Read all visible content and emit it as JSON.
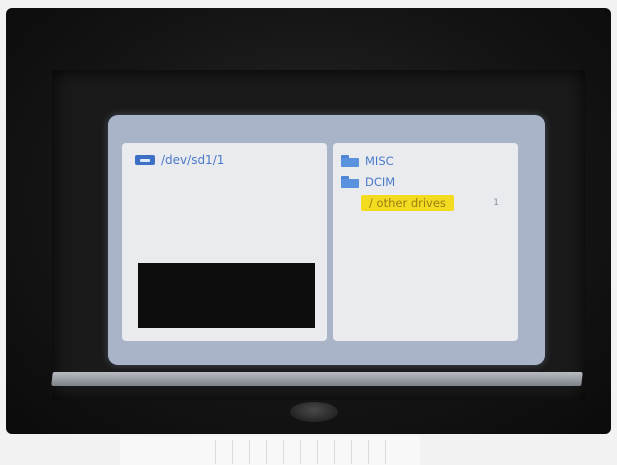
{
  "file_browser": {
    "current_path": "/dev/sd1/1",
    "entries": [
      {
        "label": "MISC",
        "icon": "folder-icon"
      },
      {
        "label": "DCIM",
        "icon": "folder-icon"
      },
      {
        "label": "/ other drives",
        "selected": true,
        "count": "1"
      }
    ]
  },
  "colors": {
    "screen_background": "#aab4c8",
    "panel_background": "#e9ebef",
    "text_blue": "#4a79c9",
    "selection_yellow": "#f3dc1f"
  }
}
